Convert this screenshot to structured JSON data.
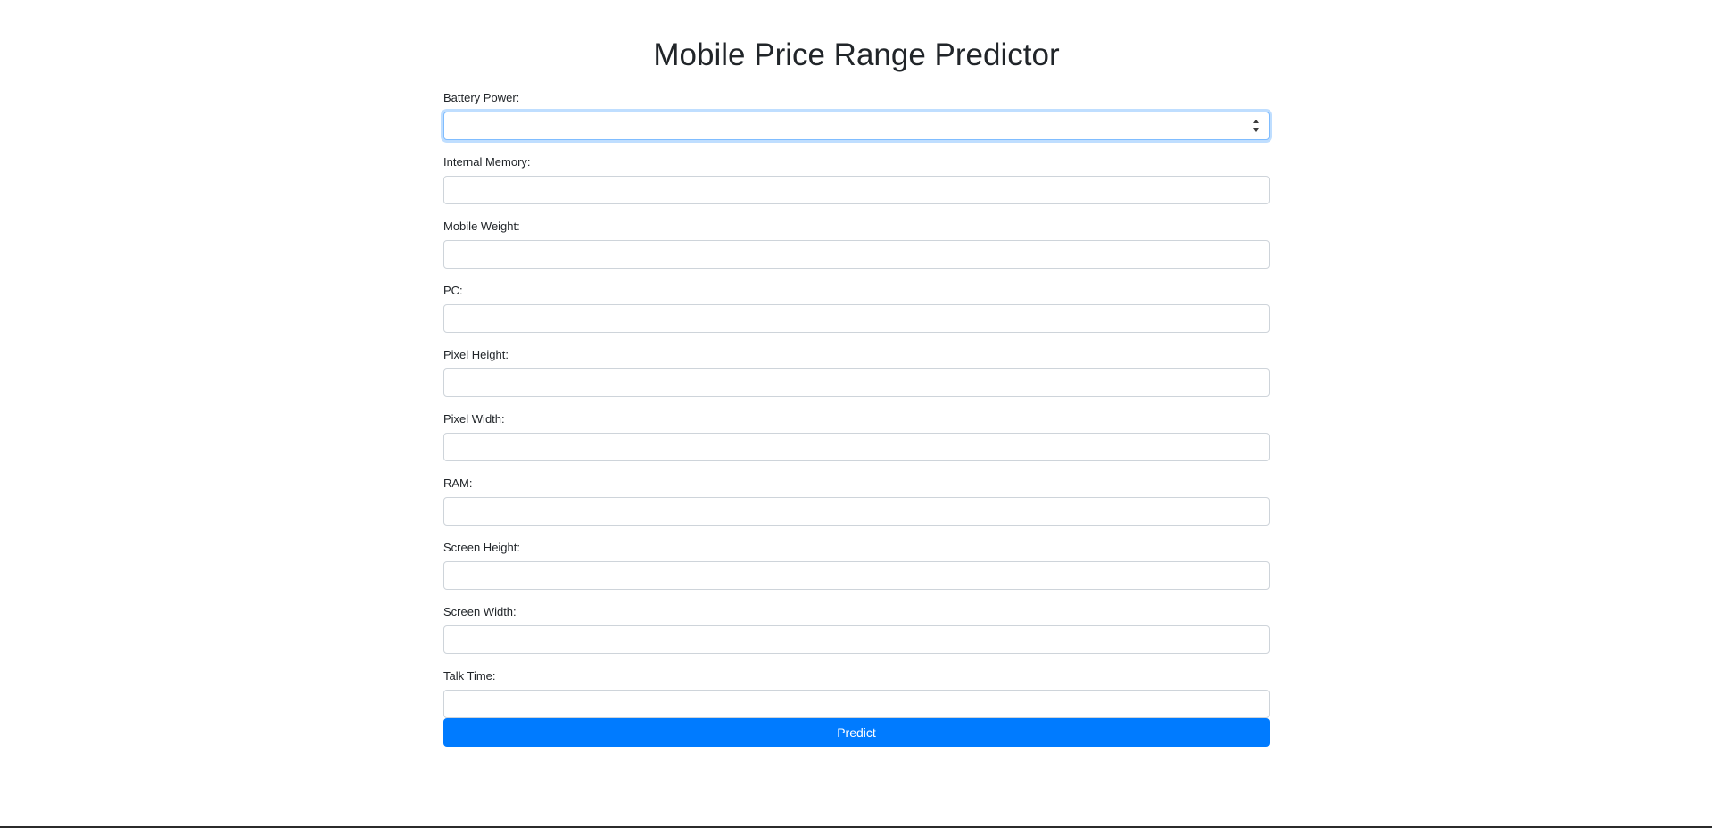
{
  "page": {
    "title": "Mobile Price Range Predictor"
  },
  "form": {
    "fields": [
      {
        "label": "Battery Power:",
        "value": "",
        "placeholder": ""
      },
      {
        "label": "Internal Memory:",
        "value": "",
        "placeholder": ""
      },
      {
        "label": "Mobile Weight:",
        "value": "",
        "placeholder": ""
      },
      {
        "label": "PC:",
        "value": "",
        "placeholder": ""
      },
      {
        "label": "Pixel Height:",
        "value": "",
        "placeholder": ""
      },
      {
        "label": "Pixel Width:",
        "value": "",
        "placeholder": ""
      },
      {
        "label": "RAM:",
        "value": "",
        "placeholder": ""
      },
      {
        "label": "Screen Height:",
        "value": "",
        "placeholder": ""
      },
      {
        "label": "Screen Width:",
        "value": "",
        "placeholder": ""
      },
      {
        "label": "Talk Time:",
        "value": "",
        "placeholder": ""
      }
    ],
    "submit_label": "Predict"
  },
  "colors": {
    "primary": "#007bff",
    "focus_border": "#80bdff",
    "input_border": "#ced4da",
    "text": "#212529"
  },
  "icons": {
    "number_spinner": "number-spinner-icon"
  }
}
